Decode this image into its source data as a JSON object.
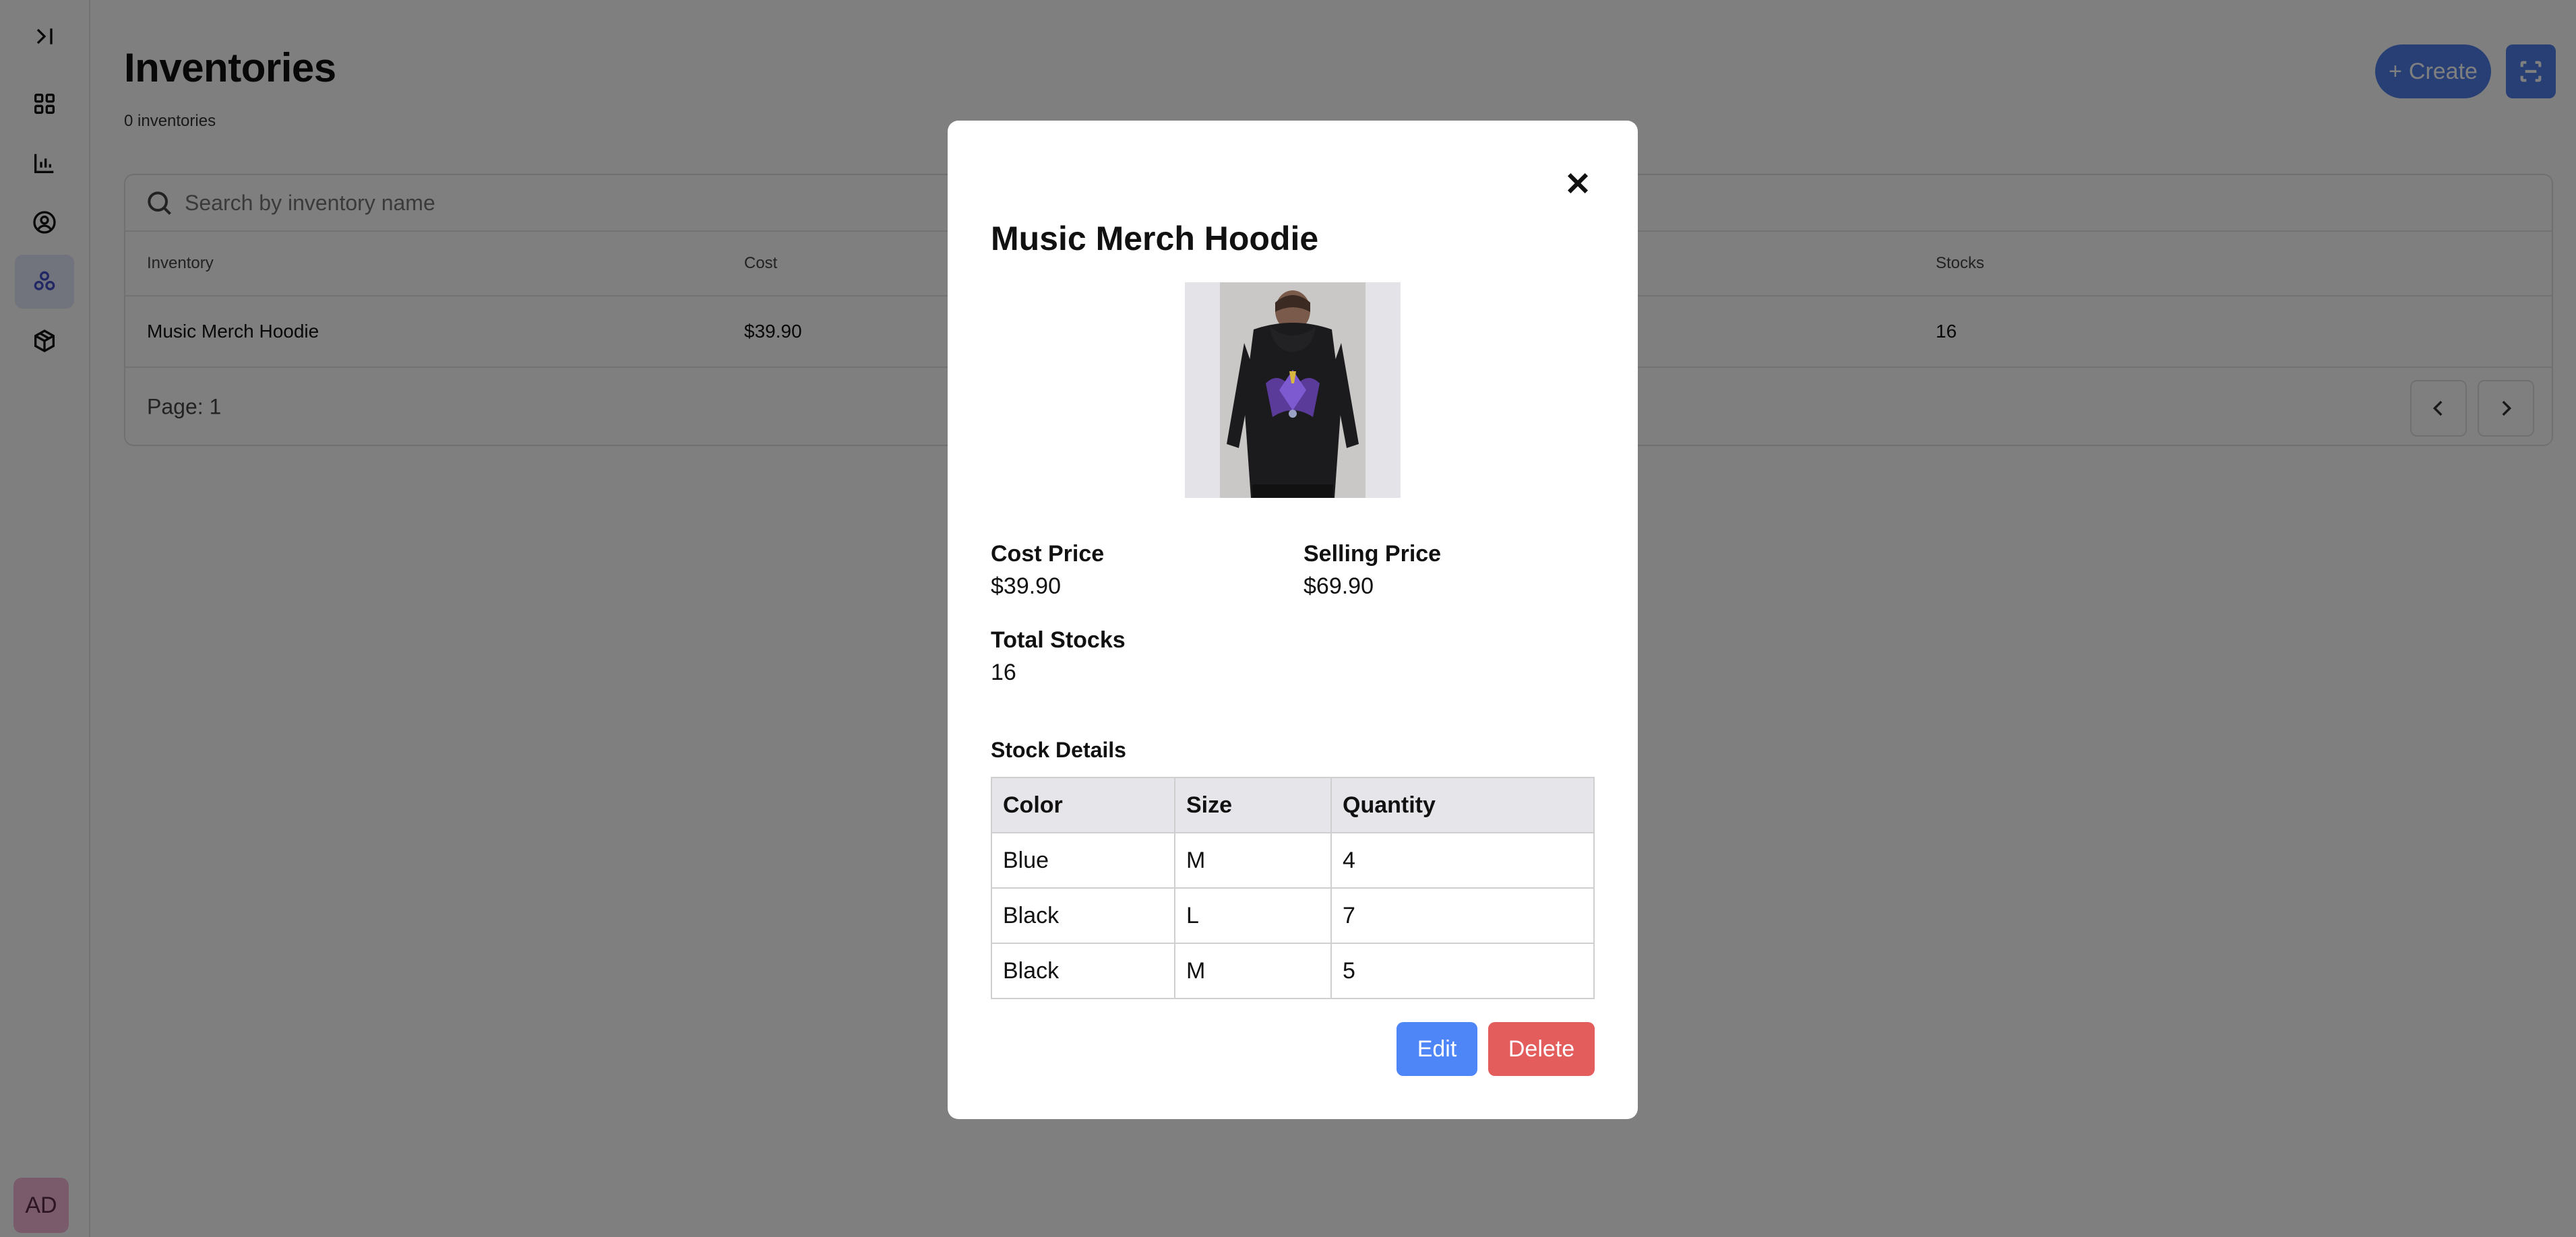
{
  "sidebar": {
    "items": [
      {
        "icon": "expand-sidebar-icon"
      },
      {
        "icon": "dashboard-icon"
      },
      {
        "icon": "analytics-icon"
      },
      {
        "icon": "user-icon"
      },
      {
        "icon": "inventory-icon",
        "active": true
      },
      {
        "icon": "package-icon"
      }
    ],
    "avatar_initials": "AD"
  },
  "header": {
    "title": "Inventories",
    "count_text": "0 inventories",
    "create_label": "Create",
    "create_icon": "+"
  },
  "search": {
    "placeholder": "Search by inventory name"
  },
  "table": {
    "columns": [
      "Inventory",
      "Cost",
      "Stocks"
    ],
    "rows": [
      {
        "inventory": "Music Merch Hoodie",
        "cost": "$39.90",
        "stocks": "16"
      }
    ]
  },
  "pagination": {
    "text": "Page: 1"
  },
  "modal": {
    "title": "Music Merch Hoodie",
    "cost_label": "Cost Price",
    "cost_value": "$39.90",
    "selling_label": "Selling Price",
    "selling_value": "$69.90",
    "stocks_label": "Total Stocks",
    "stocks_value": "16",
    "stock_details_title": "Stock Details",
    "stock_columns": [
      "Color",
      "Size",
      "Quantity"
    ],
    "stock_rows": [
      {
        "color": "Blue",
        "size": "M",
        "quantity": "4"
      },
      {
        "color": "Black",
        "size": "L",
        "quantity": "7"
      },
      {
        "color": "Black",
        "size": "M",
        "quantity": "5"
      }
    ],
    "edit_label": "Edit",
    "delete_label": "Delete"
  },
  "colors": {
    "accent": "#4f7ee8",
    "edit": "#4f86f7",
    "delete": "#e35d5d",
    "active_nav": "#e3e7fb"
  }
}
